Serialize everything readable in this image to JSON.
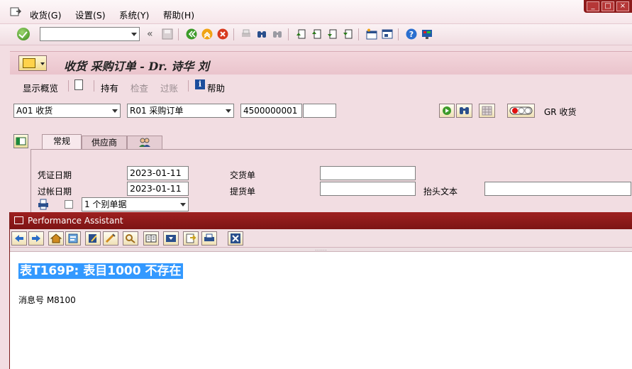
{
  "menubar": {
    "items": [
      "收货(G)",
      "设置(S)",
      "系统(Y)",
      "帮助(H)"
    ]
  },
  "stdbar": {
    "command_value": "",
    "double_arrow": "«"
  },
  "titlebar": {
    "title": "收货 采购订单 - Dr. 诗华 刘"
  },
  "appbar": {
    "overview": "显示概览",
    "hold": "持有",
    "check": "检查",
    "post": "过账",
    "help": "帮助"
  },
  "selection": {
    "action": "A01 收货",
    "reference": "R01 采购订单",
    "po_number": "4500000001",
    "item": "",
    "gr_label": "GR 收货"
  },
  "tabs": [
    "常规",
    "供应商"
  ],
  "header": {
    "doc_date_label": "凭证日期",
    "doc_date": "2023-01-11",
    "post_date_label": "过帐日期",
    "post_date": "2023-01-11",
    "delivery_note_label": "交货单",
    "delivery_note": "",
    "bill_of_lading_label": "提货单",
    "bill_of_lading": "",
    "header_text_label": "抬头文本",
    "header_text": "",
    "slip_option": "1 个别单据"
  },
  "assistant": {
    "title": "Performance Assistant",
    "message": "表T169P: 表目1000  不存在",
    "message_no": "消息号  M8100",
    "sash": "......"
  },
  "colors": {
    "titlebar_red": "#8d1a1a",
    "selection_blue": "#3399ff",
    "background": "#f2dde2"
  }
}
